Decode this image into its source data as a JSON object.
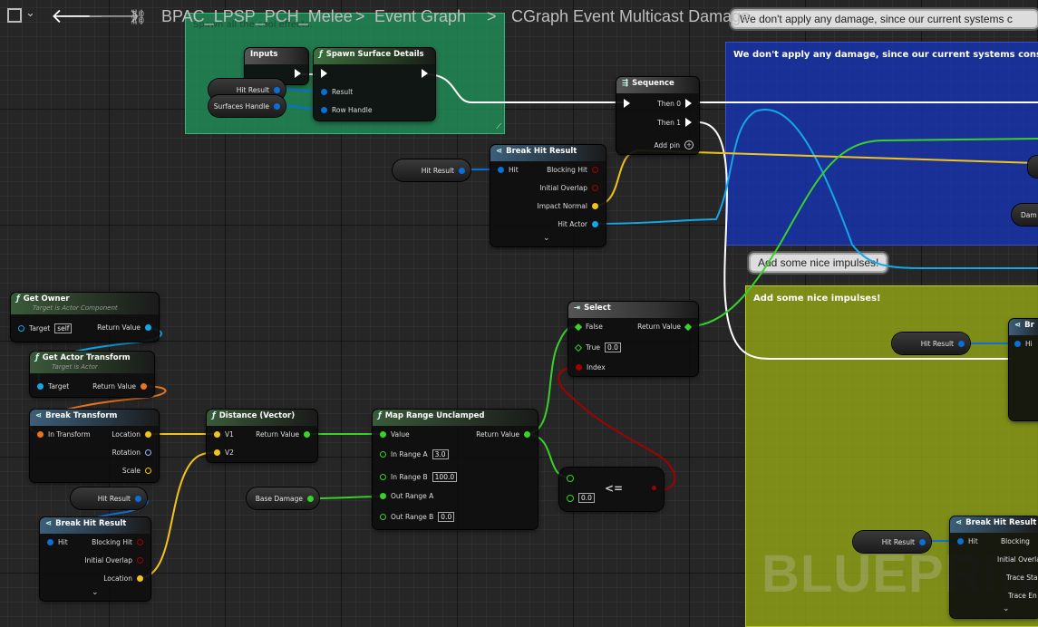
{
  "toolbar": {
    "blueprint_name": "BPAC_LPSP_PCH_Melee",
    "sep1": ">",
    "graph_name": "Event Graph",
    "sep2": ">",
    "function_name": "CGraph Event Multicast Damage"
  },
  "comments": {
    "green": {
      "title": "Spawn all the cool effects.",
      "color": "#1f8a57"
    },
    "blue": {
      "title": "We don't apply any damage, since our current systems consider ar",
      "bubble": "We don't apply any damage, since our current systems c",
      "color": "#1f3fa8"
    },
    "yellow": {
      "title": "Add some nice impulses!",
      "bubble": "Add some nice impulses!",
      "color": "#8fa11a"
    }
  },
  "nodes": {
    "inputs": {
      "title": "Inputs"
    },
    "spawn_surface": {
      "title": "Spawn Surface Details",
      "pin_result": "Result",
      "pin_row_handle": "Row Handle"
    },
    "hit_result_var1": {
      "label": "Hit Result"
    },
    "surfaces_handle_var": {
      "label": "Surfaces Handle"
    },
    "sequence": {
      "title": "Sequence",
      "then0": "Then 0",
      "then1": "Then 1",
      "add_pin": "Add pin"
    },
    "break_hit_top": {
      "title": "Break Hit Result",
      "hit": "Hit",
      "blocking": "Blocking Hit",
      "overlap": "Initial Overlap",
      "impact": "Impact Normal",
      "actor": "Hit Actor"
    },
    "hit_result_var2": {
      "label": "Hit Result"
    },
    "get_owner": {
      "title": "Get Owner",
      "subtitle": "Target is Actor Component",
      "target": "Target",
      "target_value": "self",
      "ret": "Return Value"
    },
    "get_actor_transform": {
      "title": "Get Actor Transform",
      "subtitle": "Target is Actor",
      "target": "Target",
      "ret": "Return Value"
    },
    "break_transform": {
      "title": "Break Transform",
      "in": "In Transform",
      "loc": "Location",
      "rot": "Rotation",
      "scale": "Scale"
    },
    "distance": {
      "title": "Distance (Vector)",
      "v1": "V1",
      "v2": "V2",
      "ret": "Return Value"
    },
    "map_range": {
      "title": "Map Range Unclamped",
      "value": "Value",
      "ina": "In Range A",
      "ina_val": "3.0",
      "inb": "In Range B",
      "inb_val": "100.0",
      "outa": "Out Range A",
      "outb": "Out Range B",
      "outb_val": "0.0",
      "ret": "Return Value"
    },
    "base_damage": {
      "label": "Base Damage"
    },
    "select": {
      "title": "Select",
      "false": "False",
      "true": "True",
      "true_val": "0.0",
      "index": "Index",
      "ret": "Return Value"
    },
    "compare": {
      "op": "<=",
      "val": "0.0"
    },
    "hit_result_var3": {
      "label": "Hit Result"
    },
    "break_hit_bottom": {
      "title": "Break Hit Result",
      "hit": "Hit",
      "blocking": "Blocking Hit",
      "overlap": "Initial Overlap",
      "loc": "Location"
    },
    "hit_result_var4": {
      "label": "Hit Result"
    },
    "hit_result_var5": {
      "label": "Hit Result"
    },
    "break_hit_right": {
      "title": "Break Hit Result",
      "hit": "Hit",
      "blocking": "Blocking",
      "overlap": "Initial Overla",
      "trace_start": "Trace Sta",
      "trace_end": "Trace En"
    },
    "partial_right": {
      "br": "Br",
      "hi": "Hi",
      "dam": "Dam"
    }
  },
  "watermark": "BLUEPRINT",
  "pin_colors": {
    "exec": "#ffffff",
    "struct": "#0a6fd6",
    "vector": "#f2c31b",
    "float": "#39d12a",
    "bool": "#a30000",
    "object": "#11a7e8",
    "transform": "#e8741c"
  }
}
